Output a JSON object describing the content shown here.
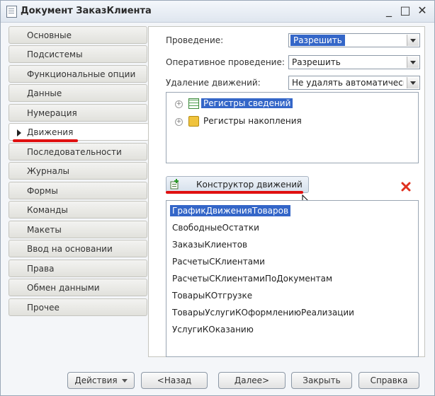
{
  "window": {
    "title": "Документ ЗаказКлиента",
    "minimize": "_",
    "maximize": "□",
    "close": "✕"
  },
  "tabs": [
    {
      "label": "Основные"
    },
    {
      "label": "Подсистемы"
    },
    {
      "label": "Функциональные опции"
    },
    {
      "label": "Данные"
    },
    {
      "label": "Нумерация"
    },
    {
      "label": "Движения",
      "active": true
    },
    {
      "label": "Последовательности"
    },
    {
      "label": "Журналы"
    },
    {
      "label": "Формы"
    },
    {
      "label": "Команды"
    },
    {
      "label": "Макеты"
    },
    {
      "label": "Ввод на основании"
    },
    {
      "label": "Права"
    },
    {
      "label": "Обмен данными"
    },
    {
      "label": "Прочее"
    }
  ],
  "settings": {
    "posting_label": "Проведение:",
    "posting_value": "Разрешить",
    "realtime_label": "Оперативное проведение:",
    "realtime_value": "Разрешить",
    "delete_label": "Удаление движений:",
    "delete_value": "Не удалять автоматически"
  },
  "tree": [
    {
      "label": "Регистры сведений",
      "icon": "info-register-icon",
      "selected": true
    },
    {
      "label": "Регистры накопления",
      "icon": "accumulation-register-icon"
    }
  ],
  "constructor_button": "Конструктор движений",
  "registers": [
    "ГрафикДвиженияТоваров",
    "СвободныеОстатки",
    "ЗаказыКлиентов",
    "РасчетыСКлиентами",
    "РасчетыСКлиентамиПоДокументам",
    "ТоварыКОтгрузке",
    "ТоварыУслугиКОформлениюРеализации",
    "УслугиКОказанию"
  ],
  "footer": {
    "actions": "Действия",
    "back": "<Назад",
    "next": "Далее>",
    "close": "Закрыть",
    "help": "Справка"
  },
  "colors": {
    "selection": "#3466c8",
    "highlight_underline": "#e01010",
    "delete_icon": "#e0301e"
  }
}
